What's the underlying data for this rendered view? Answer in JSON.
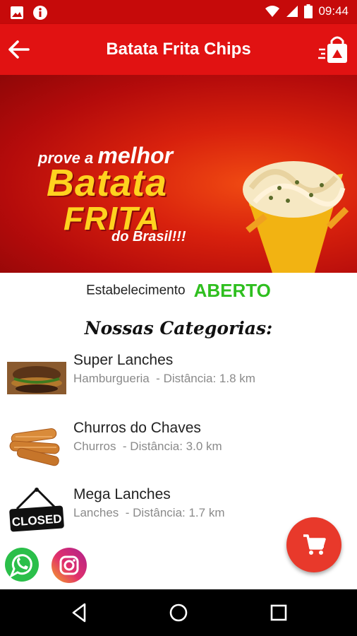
{
  "status_bar": {
    "time": "09:44",
    "icons": [
      "image-icon",
      "info-icon",
      "wifi-icon",
      "signal-icon",
      "battery-icon"
    ]
  },
  "app_bar": {
    "title": "Batata Frita Chips",
    "back_icon": "arrow-left-icon",
    "bag_icon": "shopping-bag-icon"
  },
  "banner": {
    "line1_small": "prove a ",
    "line1_big": "melhor",
    "line2": "Batata",
    "line3": "FRITA",
    "line4": "do Brasil!!!"
  },
  "establishment": {
    "label": "Estabelecimento",
    "status": "ABERTO"
  },
  "categories_title": "Nossas Categorias:",
  "categories": [
    {
      "name": "Super Lanches",
      "type": "Hamburgueria",
      "distance": "  - Distância: 1.8 km",
      "thumb": "burger-image"
    },
    {
      "name": "Churros do Chaves",
      "type": "Churros",
      "distance": "  - Distância: 3.0 km",
      "thumb": "churros-image"
    },
    {
      "name": "Mega Lanches",
      "type": "Lanches",
      "distance": "  - Distância: 1.7 km",
      "thumb": "closed-sign-image",
      "thumb_text": "CLOSED"
    }
  ],
  "colors": {
    "primary": "#e11212",
    "status_bar": "#c60a0a",
    "open_green": "#2fbf1f",
    "fab": "#e8392b",
    "secondary_text": "#8a8a8a"
  }
}
